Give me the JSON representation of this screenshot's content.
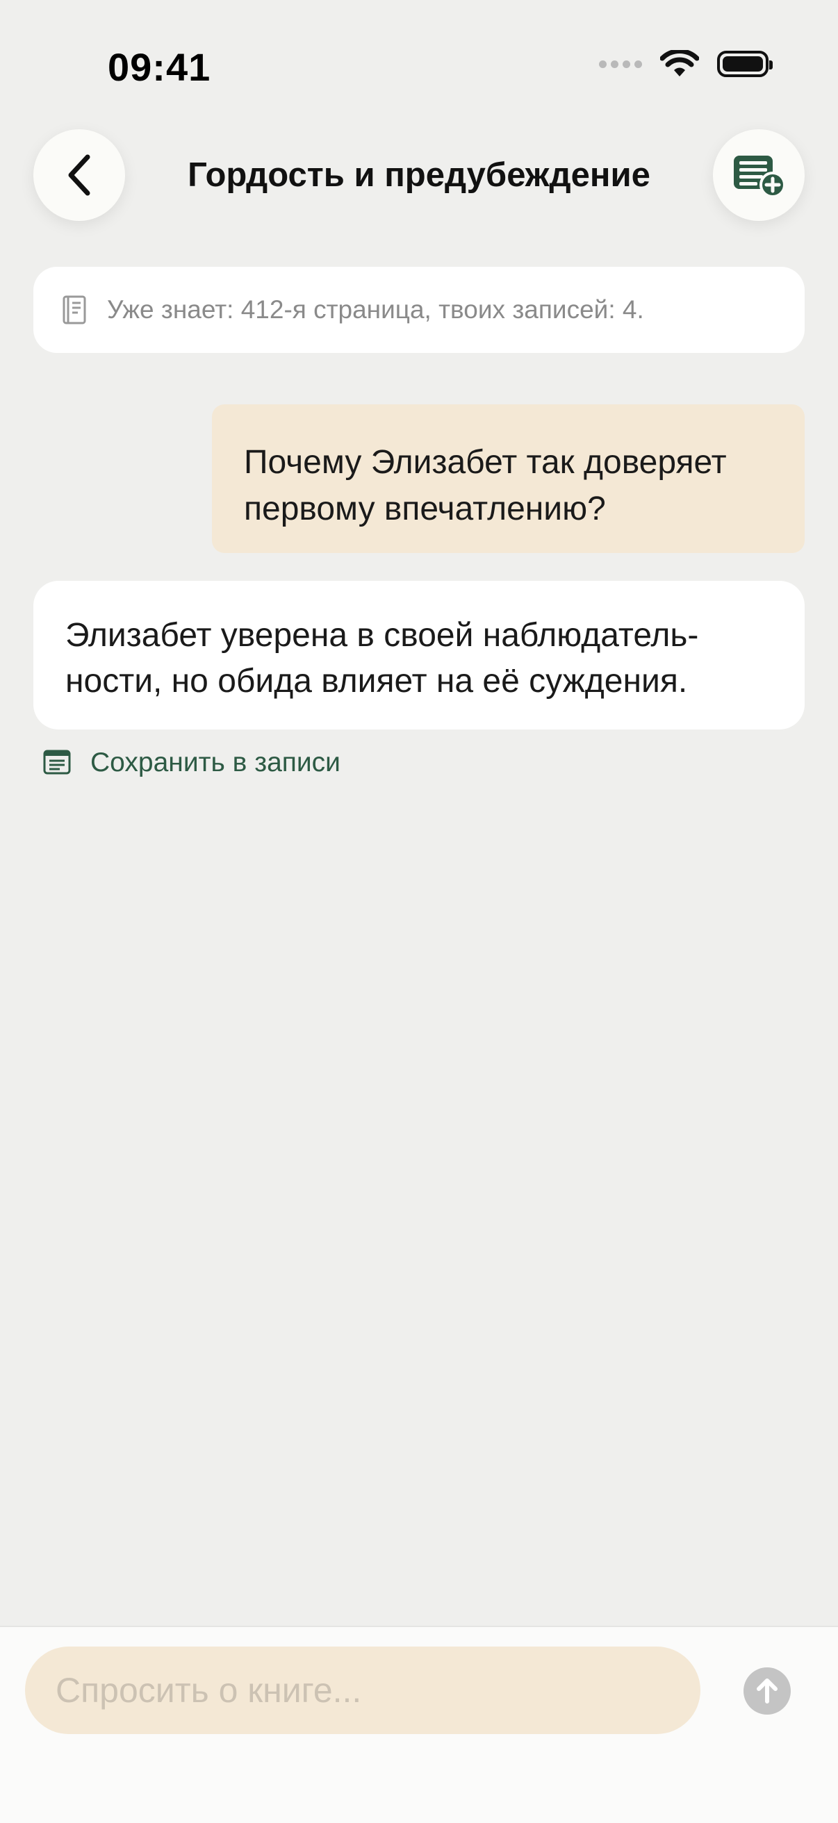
{
  "status_bar": {
    "time": "09:41"
  },
  "header": {
    "title": "Гордость и предубеждение",
    "back_icon": "chevron-left-icon",
    "notes_icon": "note-add-icon"
  },
  "context": {
    "icon": "book-icon",
    "text": "Уже знает: 412-я страница, твоих записей: 4."
  },
  "conversation": {
    "user_message": "Почему Элизабет так доверяет первому впечатлению?",
    "assistant_message": "Элизабет уверена в своей наблюдатель-ности, но обида влияет на её суждения.",
    "save_label": "Сохранить в записи"
  },
  "composer": {
    "placeholder": "Спросить о книге...",
    "value": ""
  },
  "colors": {
    "background": "#efefed",
    "accent": "#2d5a44",
    "user_bubble": "#f4e8d5",
    "send_disabled": "#c4c4c4"
  }
}
